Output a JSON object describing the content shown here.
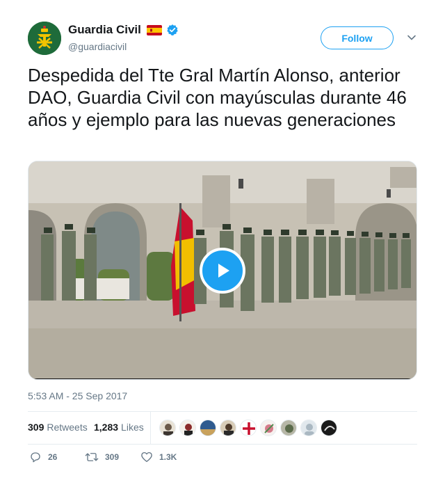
{
  "account": {
    "name": "Guardia Civil",
    "handle": "@guardiacivil",
    "verified": true,
    "flag": "spain-flag-emoji"
  },
  "follow_label": "Follow",
  "tweet": {
    "text": "Despedida del Tte Gral Martín Alonso, anterior DAO, Guardia Civil con mayúsculas durante 46 años y ejemplo para las nuevas generaciones",
    "media": {
      "type": "video",
      "play_icon": "play-icon"
    },
    "timestamp": "5:53 AM - 25 Sep 2017"
  },
  "stats": {
    "retweets": "309",
    "retweets_label": "Retweets",
    "likes": "1,283",
    "likes_label": "Likes",
    "liker_count": 9
  },
  "actions": {
    "replies": "26",
    "retweets": "309",
    "likes": "1.3K"
  },
  "colors": {
    "accent": "#1da1f2",
    "text": "#14171a",
    "muted": "#657786",
    "brand_green": "#1e6b3a"
  }
}
